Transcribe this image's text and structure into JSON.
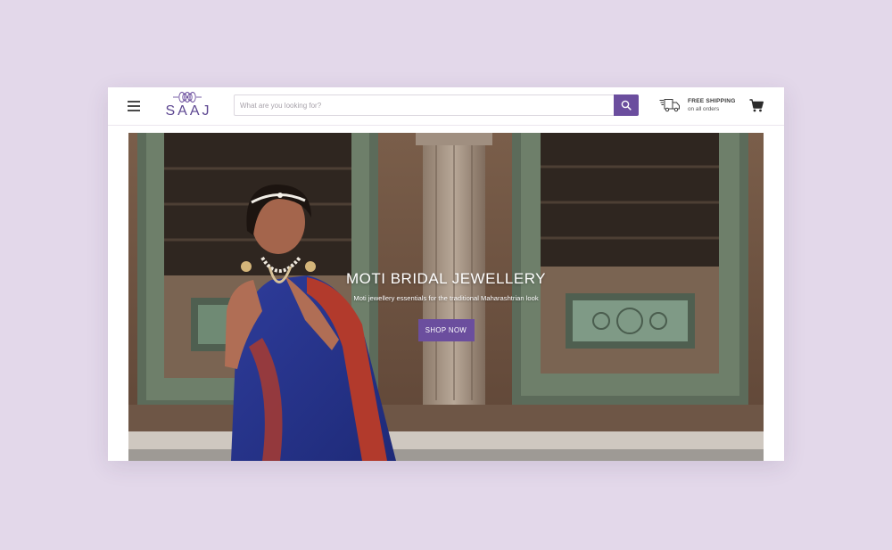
{
  "header": {
    "menu_icon": "hamburger-menu-icon",
    "logo": {
      "text": "SAAJ",
      "icon": "ornament-logo-icon"
    },
    "search": {
      "placeholder": "What are you looking for?",
      "value": "",
      "button_icon": "search-icon"
    },
    "shipping": {
      "icon": "delivery-truck-icon",
      "title": "FREE SHIPPING",
      "subtitle": "on all orders"
    },
    "cart_icon": "shopping-cart-icon"
  },
  "hero": {
    "image": "woman-in-blue-saree-with-moti-jewellery",
    "title": "MOTI BRIDAL JEWELLERY",
    "subtitle": "Moti jewellery essentials for the traditional Maharashtrian look",
    "cta_label": "SHOP NOW"
  },
  "colors": {
    "background": "#e3d8ea",
    "brand_purple": "#6b4e9e",
    "logo_purple": "#5d4791"
  }
}
